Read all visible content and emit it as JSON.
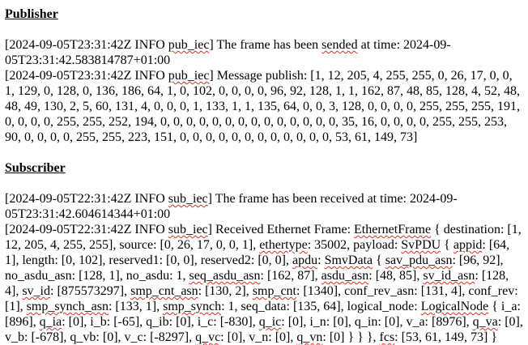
{
  "publisher": {
    "heading": "Publisher",
    "lines": [
      [
        {
          "t": "[2024-09-05T23:31:42Z INFO  "
        },
        {
          "t": "pub_iec",
          "sq": true
        },
        {
          "t": "] The frame has been "
        },
        {
          "t": "sended",
          "sq": true
        },
        {
          "t": " at time: 2024-09-05T23:31:42.583814787+01:00"
        }
      ],
      [
        {
          "t": "[2024-09-05T23:31:42Z INFO  "
        },
        {
          "t": "pub_iec",
          "sq": true
        },
        {
          "t": "] Message publish: [1, 12, 205, 4, 255, 255, 0, 26, 17, 0, 0, 1, 129, 0, 128, 0, 136, 186, 64, 1, 0, 102, 0, 0, 0, 0, 96, 92, 128, 1, 1, 162, 87, 48, 85, 128, 4, 52, 48, 48, 49, 130, 2, 5, 60, 131, 4, 0, 0, 0, 1, 133, 1, 1, 135, 64, 0, 0, 3, 128, 0, 0, 0, 0, 255, 255, 255, 191, 0, 0, 0, 0, 255, 255, 252, 194, 0, 0, 0, 0, 0, 0, 0, 0, 0, 0, 0, 0, 0, 0, 35, 16, 0, 0, 0, 0, 255, 255, 253, 90, 0, 0, 0, 0, 255, 255, 223, 151, 0, 0, 0, 0, 0, 0, 0, 0, 0, 0, 0, 0, 53, 61, 149, 73]"
        }
      ]
    ]
  },
  "subscriber": {
    "heading": "Subscriber",
    "lines": [
      [
        {
          "t": "[2024-09-05T22:31:42Z INFO  "
        },
        {
          "t": "sub_iec",
          "sq": true
        },
        {
          "t": "] The frame has been received at time: 2024-09-05T23:31:42.604614344+01:00"
        }
      ],
      [
        {
          "t": "[2024-09-05T22:31:42Z INFO  "
        },
        {
          "t": "sub_iec",
          "sq": true
        },
        {
          "t": "] Received Ethernet Frame: "
        },
        {
          "t": "EthernetFrame",
          "sq": true
        },
        {
          "t": " { destination: [1, 12, 205, 4, 255, 255], source: [0, 26, 17, 0, 0, 1], "
        },
        {
          "t": "ethertype",
          "sq": true
        },
        {
          "t": ": 35002, payload: "
        },
        {
          "t": "SvPDU",
          "sq": true
        },
        {
          "t": " { "
        },
        {
          "t": "appid",
          "sq": true
        },
        {
          "t": ": [64, 1], length: [0, 102], reserved1: [0, 0], reserved2: [0, 0], "
        },
        {
          "t": "apdu",
          "sq": true
        },
        {
          "t": ": "
        },
        {
          "t": "SmvData",
          "sq": true
        },
        {
          "t": " { "
        },
        {
          "t": "sav_pdu_asn",
          "sq": true
        },
        {
          "t": ": [96, 92], no_asdu_asn: [128, 1], no_asdu: 1, "
        },
        {
          "t": "seq_asdu_asn",
          "sq": true
        },
        {
          "t": ": [162, 87], "
        },
        {
          "t": "asdu_asn",
          "sq": true
        },
        {
          "t": ": [48, 85], "
        },
        {
          "t": "sv_id_asn",
          "sq": true
        },
        {
          "t": ": [128, 4], "
        },
        {
          "t": "sv_id",
          "sq": true
        },
        {
          "t": ": [875573297], "
        },
        {
          "t": "smp_cnt_asn",
          "sq": true
        },
        {
          "t": ": [130, 2], "
        },
        {
          "t": "smp_cnt",
          "sq": true
        },
        {
          "t": ": [1340], conf_rev_asn: [131, 4], conf_rev: [1], "
        },
        {
          "t": "smp_synch_asn",
          "sq": true
        },
        {
          "t": ": [133, 1], "
        },
        {
          "t": "smp_synch",
          "sq": true
        },
        {
          "t": ": 1, seq_data: [135, 64], logical_node: "
        },
        {
          "t": "LogicalNode",
          "sq": true
        },
        {
          "t": " { i_a: [896], "
        },
        {
          "t": "q_ia",
          "sq": true
        },
        {
          "t": ": [0], i_b: [-65], q_ib: [0], i_c: [-830], "
        },
        {
          "t": "q_ic",
          "sq": true
        },
        {
          "t": ": [0], i_n: [0], q_in: [0], v_a: [8976], "
        },
        {
          "t": "q_va",
          "sq": true
        },
        {
          "t": ": [0], v_b: [-678], q_vb: [0], v_c: [-8297], "
        },
        {
          "t": "q_vc",
          "sq": true
        },
        {
          "t": ": [0], v_n: [0], "
        },
        {
          "t": "q_vn",
          "sq": true
        },
        {
          "t": ": [0] } } }, "
        },
        {
          "t": "fcs",
          "sq": true
        },
        {
          "t": ": [53, 61, 149, 73] }"
        }
      ]
    ]
  },
  "colors": {
    "text": "#000000",
    "spellcheck_underline": "#d93025",
    "background": "#ffffff"
  }
}
